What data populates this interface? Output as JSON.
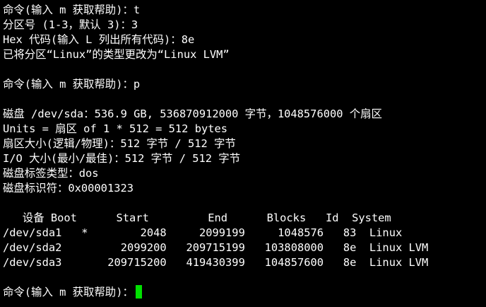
{
  "terminal": {
    "lines": [
      "命令(输入 m 获取帮助)：t",
      "分区号 (1-3，默认 3)：3",
      "Hex 代码(输入 L 列出所有代码)：8e",
      "已将分区“Linux”的类型更改为“Linux LVM”",
      "",
      "命令(输入 m 获取帮助)：p",
      "",
      "磁盘 /dev/sda：536.9 GB, 536870912000 字节，1048576000 个扇区",
      "Units = 扇区 of 1 * 512 = 512 bytes",
      "扇区大小(逻辑/物理)：512 字节 / 512 字节",
      "I/O 大小(最小/最佳)：512 字节 / 512 字节",
      "磁盘标签类型：dos",
      "磁盘标识符：0x00001323",
      "",
      "   设备 Boot      Start         End      Blocks   Id  System",
      "/dev/sda1   *        2048     2099199     1048576   83  Linux",
      "/dev/sda2         2099200   209715199   103808000   8e  Linux LVM",
      "/dev/sda3       209715200   419430399   104857600   8e  Linux LVM",
      "",
      "命令(输入 m 获取帮助)："
    ],
    "cursor_color": "#00e000",
    "background_color": "#000000",
    "text_color": "#ffffff"
  }
}
